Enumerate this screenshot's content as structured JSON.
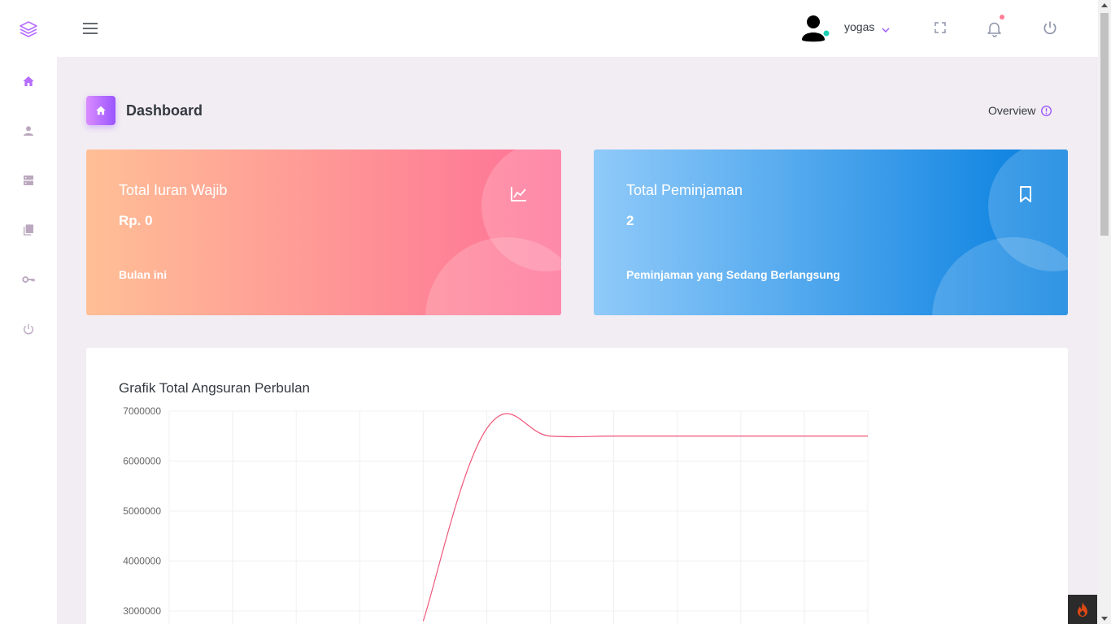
{
  "sidebar": {
    "brand_icon": "layers-icon",
    "items": [
      {
        "icon": "home-icon",
        "active": true
      },
      {
        "icon": "user-icon"
      },
      {
        "icon": "server-icon"
      },
      {
        "icon": "books-icon"
      },
      {
        "icon": "key-icon"
      },
      {
        "icon": "power-icon"
      }
    ]
  },
  "topbar": {
    "user_name": "yogas",
    "status_color": "#1bcfb4",
    "notification_color": "#fe7c96"
  },
  "page": {
    "title": "Dashboard",
    "overview_label": "Overview"
  },
  "cards": [
    {
      "title": "Total Iuran Wajib",
      "value": "Rp. 0",
      "subtitle": "Bulan ini",
      "icon": "chart-line-icon"
    },
    {
      "title": "Total Peminjaman",
      "value": "2",
      "subtitle": "Peminjaman yang Sedang Berlangsung",
      "icon": "bookmark-icon"
    }
  ],
  "colors": {
    "accent": "#9a55ff",
    "line": "#f0587a"
  },
  "chart_data": {
    "type": "line",
    "title": "Grafik Total Angsuran Perbulan",
    "y_ticks_visible": [
      "7000000",
      "6000000",
      "5000000",
      "4000000",
      "3000000"
    ],
    "ylim_visible": [
      3000000,
      7000000
    ],
    "grid": true,
    "series": [
      {
        "values": [
          null,
          null,
          null,
          null,
          2800000,
          6650000,
          6500000,
          6500000,
          6500000,
          6500000,
          6500000,
          6500000
        ]
      }
    ]
  }
}
